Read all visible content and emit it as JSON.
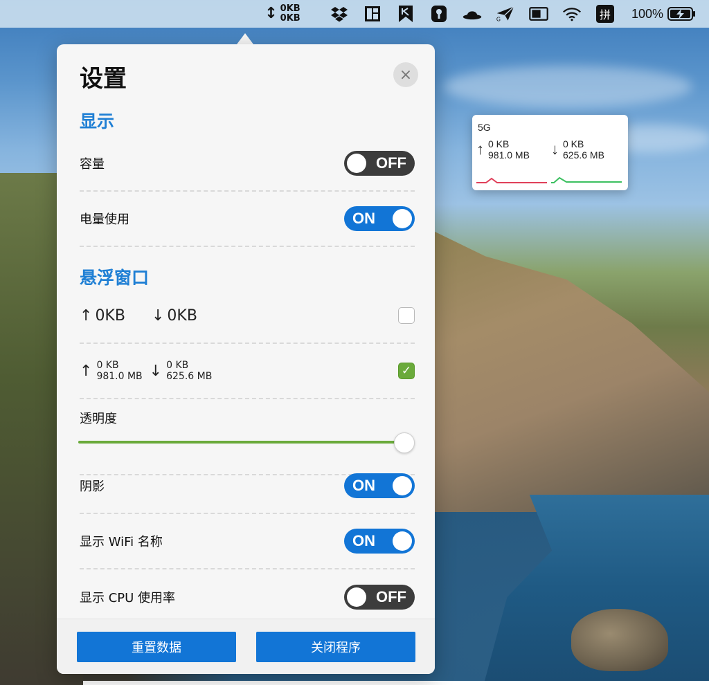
{
  "menubar": {
    "speed_up": "0KB",
    "speed_down": "0KB",
    "tray_icons": [
      "dropbox-icon",
      "layout-icon",
      "app-k-icon",
      "keychain-icon",
      "bowler-hat-icon",
      "paper-plane-icon",
      "display-icon",
      "wifi-icon"
    ],
    "input_method": "拼",
    "battery_percent": "100%"
  },
  "settings": {
    "title": "设置",
    "close_icon": "×",
    "display_section": {
      "title": "显示",
      "capacity_label": "容量",
      "capacity_state": "OFF",
      "power_label": "电量使用",
      "power_state": "ON"
    },
    "floating_section": {
      "title": "悬浮窗口",
      "format_simple": {
        "up": "0KB",
        "down": "0KB",
        "checked": false
      },
      "format_detailed": {
        "up_speed": "0 KB",
        "up_total": "981.0 MB",
        "down_speed": "0 KB",
        "down_total": "625.6 MB",
        "checked": true
      },
      "opacity_label": "透明度",
      "opacity_value": 1.0,
      "shadow_label": "阴影",
      "shadow_state": "ON",
      "wifi_name_label": "显示 WiFi 名称",
      "wifi_name_state": "ON",
      "cpu_label": "显示 CPU 使用率",
      "cpu_state": "OFF"
    },
    "footer": {
      "reset_button": "重置数据",
      "quit_button": "关闭程序"
    }
  },
  "floating_window": {
    "ssid": "5G",
    "up_speed": "0 KB",
    "up_total": "981.0 MB",
    "down_speed": "0 KB",
    "down_total": "625.6 MB",
    "up_color": "#e0405a",
    "down_color": "#3cc060"
  },
  "colors": {
    "accent": "#1275d6",
    "section": "#1f7fd4",
    "toggle_off": "#3c3c3c",
    "check_green": "#6aaa3b"
  }
}
